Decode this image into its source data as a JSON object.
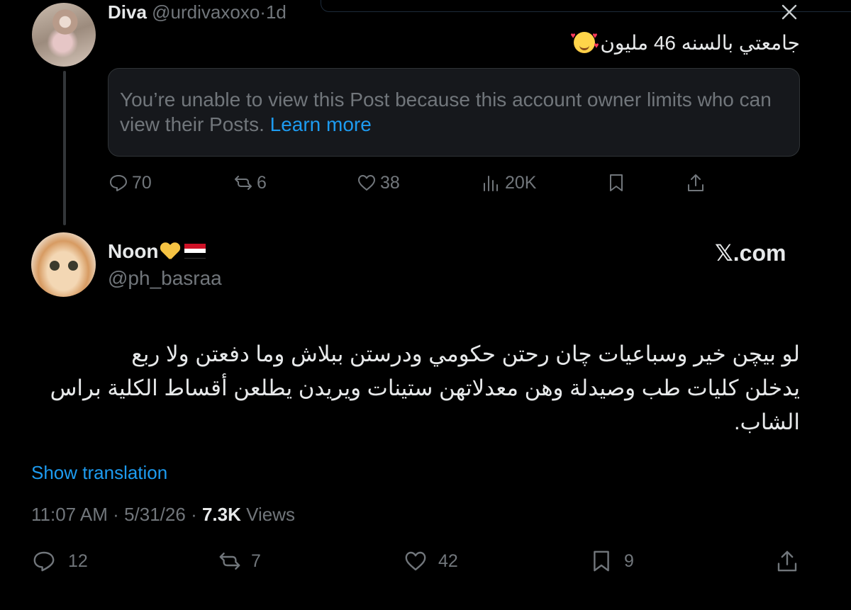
{
  "quoted_post": {
    "author_name": "Diva",
    "author_handle": "@urdivaxoxo",
    "separator": "·",
    "time": "1d",
    "text": "جامعتي بالسنه 46 مليون",
    "restricted_message": "You’re unable to view this Post because this account owner limits who can view their Posts.",
    "learn_more": "Learn more",
    "actions": {
      "replies": "70",
      "reposts": "6",
      "likes": "38",
      "views": "20K"
    }
  },
  "main_post": {
    "author_name": "Noon",
    "author_handle": "@ph_basraa",
    "brand": "𝕏.com",
    "text_lines": [
      "لو بيچن خير وسباعيات چان رحتن حكومي ودرستن ببلاش وما دفعتن ولا ربع",
      "يدخلن كليات طب وصيدلة وهن معدلاتهن ستينات ويريدن يطلعن أقساط الكلية براس",
      "الشاب."
    ],
    "show_translation": "Show translation",
    "time": "11:07 AM",
    "separator": "·",
    "date": "5/31/26",
    "views_count": "7.3K",
    "views_label": "Views",
    "actions": {
      "replies": "12",
      "reposts": "7",
      "likes": "42",
      "bookmarks": "9"
    }
  },
  "colors": {
    "background": "#000000",
    "text_primary": "#e7e9ea",
    "text_secondary": "#71767b",
    "link": "#1d9bf0",
    "card_background": "#16181c",
    "border": "#2f3336"
  },
  "icons": [
    "close-icon",
    "reply-icon",
    "repost-icon",
    "like-icon",
    "views-icon",
    "bookmark-icon",
    "share-icon",
    "yellow-heart-emoji",
    "iraq-flag-emoji",
    "smiling-face-with-hearts-emoji"
  ]
}
